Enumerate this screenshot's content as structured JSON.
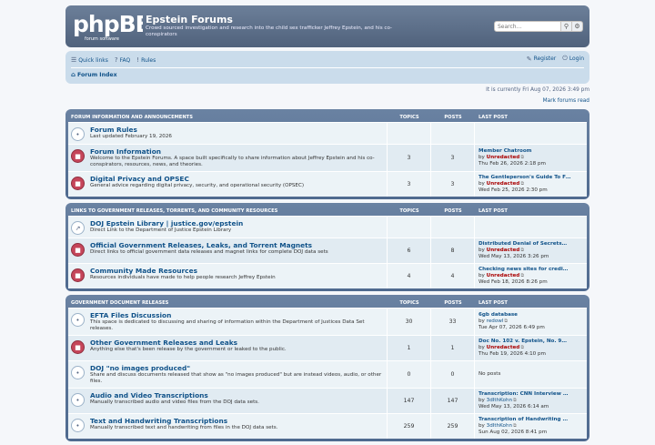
{
  "site": {
    "logo_text": "phpBB",
    "logo_sub": "forum software",
    "title": "Epstein Forums",
    "description": "Crowd sourced investigation and research into the child sex trafficker Jeffrey Epstein, and his co-conspirators"
  },
  "search": {
    "placeholder": "Search…"
  },
  "nav": {
    "quick_links": "Quick links",
    "faq": "FAQ",
    "rules": "Rules",
    "register": "Register",
    "login": "Login",
    "breadcrumb": "Forum Index"
  },
  "timeline": "It is currently Fri Aug 07, 2026 3:49 pm",
  "mark_read": "Mark forums read",
  "columns": {
    "topics": "TOPICS",
    "posts": "POSTS",
    "last_post": "LAST POST"
  },
  "categories": [
    {
      "name": "FORUM INFORMATION AND ANNOUNCEMENTS",
      "forums": [
        {
          "icon": "read",
          "title": "Forum Rules",
          "desc": "Last updated February 19, 2026",
          "topics": "",
          "posts": "",
          "lp_title": "",
          "lp_by": "",
          "lp_user": "",
          "lp_date": ""
        },
        {
          "icon": "unread",
          "title": "Forum Information",
          "desc": "Welcome to the Epstein Forums. A space built specifically to share information about Jeffrey Epstein and his co-conspirators, resources, news, and theories.",
          "topics": "3",
          "posts": "3",
          "lp_title": "Member Chatroom",
          "lp_by": "by",
          "lp_user": "Unredacted",
          "lp_date": "Thu Feb 26, 2026 2:18 pm"
        },
        {
          "icon": "unread",
          "title": "Digital Privacy and OPSEC",
          "desc": "General advice regarding digital privacy, security, and operational security (OPSEC)",
          "topics": "3",
          "posts": "3",
          "lp_title": "The Gentleperson's Guide To F…",
          "lp_by": "by",
          "lp_user": "Unredacted",
          "lp_date": "Wed Feb 25, 2026 2:30 pm"
        }
      ]
    },
    {
      "name": "LINKS TO GOVERNMENT RELEASES, TORRENTS, AND COMMUNITY RESOURCES",
      "forums": [
        {
          "icon": "link",
          "title": "DOJ Epstein Library | justice.gov/epstein",
          "desc": "Direct Link to the Department of Justice Epstein Library",
          "topics": "",
          "posts": "",
          "lp_title": "",
          "lp_by": "",
          "lp_user": "",
          "lp_date": ""
        },
        {
          "icon": "unread",
          "title": "Official Government Releases, Leaks, and Torrent Magnets",
          "desc": "Direct links to official government data releases and magnet links for complete DOJ data sets",
          "topics": "6",
          "posts": "8",
          "lp_title": "Distributed Denial of Secrets…",
          "lp_by": "by",
          "lp_user": "Unredacted",
          "lp_date": "Wed May 13, 2026 3:26 pm"
        },
        {
          "icon": "unread",
          "title": "Community Made Resources",
          "desc": "Resources individuals have made to help people research Jeffrey Epstein",
          "topics": "4",
          "posts": "4",
          "lp_title": "Checking news sites for credi…",
          "lp_by": "by",
          "lp_user": "Unredacted",
          "lp_date": "Wed Feb 18, 2026 8:26 pm"
        }
      ]
    },
    {
      "name": "GOVERNMENT DOCUMENT RELEASES",
      "forums": [
        {
          "icon": "read",
          "title": "EFTA Files Discussion",
          "desc": "This space is dedicated to discussing and sharing of information within the Department of Justices Data Set releases.",
          "topics": "30",
          "posts": "33",
          "lp_title": "6gb database",
          "lp_by": "by",
          "lp_user": "redowl",
          "lp_user_blue": true,
          "lp_date": "Tue Apr 07, 2026 6:49 pm"
        },
        {
          "icon": "unread",
          "title": "Other Government Releases and Leaks",
          "desc": "Anything else that's been release by the government or leaked to the public.",
          "topics": "1",
          "posts": "1",
          "lp_title": "Doc No. 102 v. Epstein, No. 9…",
          "lp_by": "by",
          "lp_user": "Unredacted",
          "lp_date": "Thu Feb 19, 2026 4:10 pm"
        },
        {
          "icon": "read",
          "title": "DOJ \"no images produced\"",
          "desc": "Share and discuss documents released that show as \"no images produced\" but are instead videos, audio, or other files.",
          "topics": "0",
          "posts": "0",
          "lp_none": "No posts",
          "lp_title": "",
          "lp_by": "",
          "lp_user": "",
          "lp_date": ""
        },
        {
          "icon": "read",
          "title": "Audio and Video Transcriptions",
          "desc": "Manually transcribed audio and video files from the DOJ data sets.",
          "topics": "147",
          "posts": "147",
          "lp_title": "Transcription: CNN Interview …",
          "lp_by": "by",
          "lp_user": "3dIthKohn",
          "lp_user_blue": true,
          "lp_date": "Wed May 13, 2026 6:14 am"
        },
        {
          "icon": "read",
          "title": "Text and Handwriting Transcriptions",
          "desc": "Manually transcribed text and handwriting from files in the DOJ data sets.",
          "topics": "259",
          "posts": "259",
          "lp_title": "Transcription of Handwriting …",
          "lp_by": "by",
          "lp_user": "3dIthKohn",
          "lp_user_blue": true,
          "lp_date": "Sun Aug 02, 2026 8:41 pm"
        }
      ]
    }
  ]
}
